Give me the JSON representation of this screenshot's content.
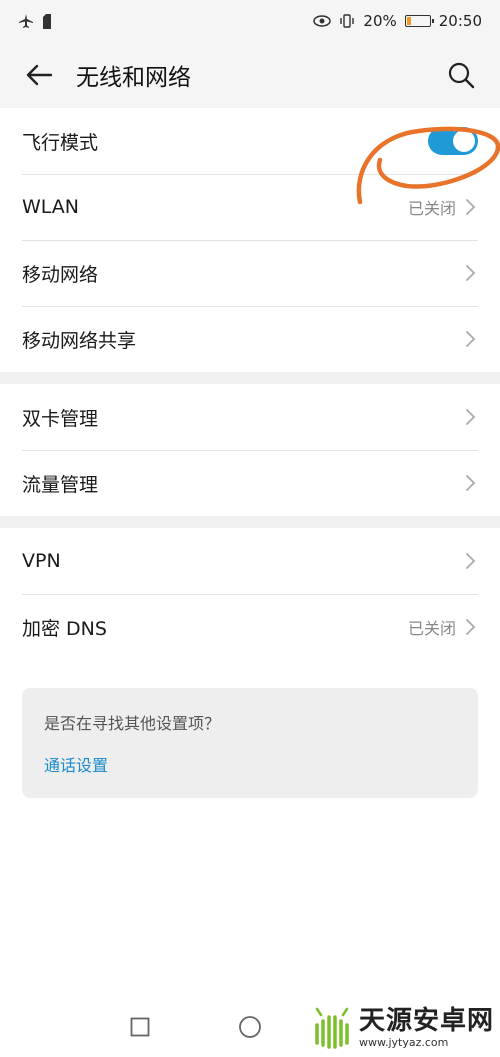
{
  "status_bar": {
    "battery_percent": "20%",
    "time": "20:50",
    "battery_level": 0.2,
    "icons": [
      "airplane-icon",
      "sim-icon",
      "eye-icon",
      "vibrate-icon",
      "battery-icon"
    ]
  },
  "header": {
    "title": "无线和网络",
    "back_icon": "arrow-left-icon",
    "search_icon": "search-icon"
  },
  "group1": {
    "items": [
      {
        "label": "飞行模式",
        "type": "toggle",
        "on": true
      },
      {
        "label": "WLAN",
        "status": "已关闭"
      },
      {
        "label": "移动网络"
      },
      {
        "label": "移动网络共享"
      }
    ]
  },
  "group2": {
    "items": [
      {
        "label": "双卡管理"
      },
      {
        "label": "流量管理"
      }
    ]
  },
  "group3": {
    "items": [
      {
        "label": "VPN"
      },
      {
        "label": "加密 DNS",
        "status": "已关闭"
      }
    ]
  },
  "suggestion": {
    "question": "是否在寻找其他设置项？",
    "link": "通话设置"
  },
  "watermark": {
    "title": "天源安卓网",
    "url": "www.jytyaz.com"
  },
  "colors": {
    "accent": "#1f9ad6",
    "link": "#1a8bcc",
    "annotation": "#e8732a",
    "background": "#f5f5f5"
  }
}
